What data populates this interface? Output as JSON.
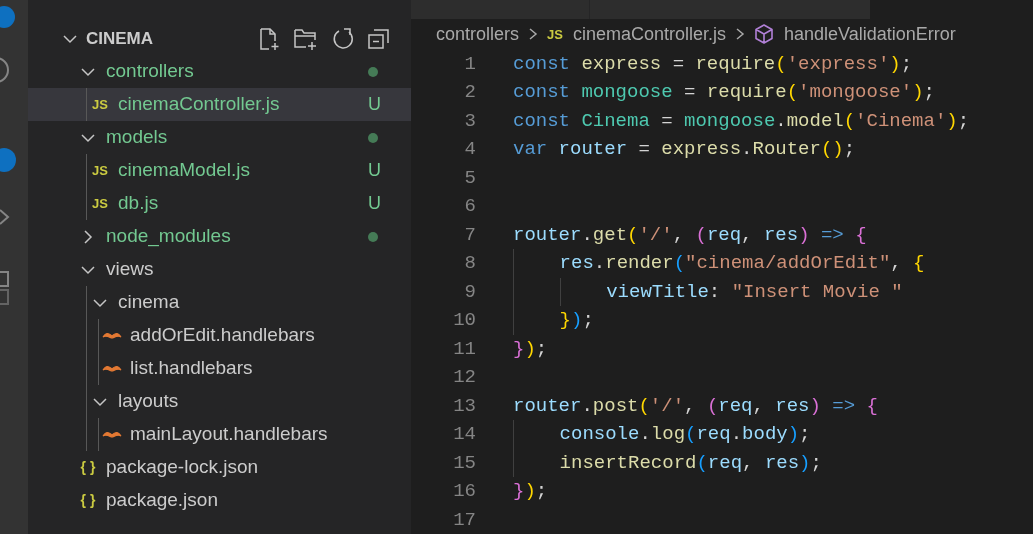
{
  "explorer": {
    "folder": "CINEMA",
    "expanded": true,
    "tree": [
      {
        "name": "controllers",
        "kind": "folder",
        "expanded": true,
        "untracked": true,
        "dot": true,
        "selected": false,
        "children": [
          {
            "name": "cinemaController.js",
            "kind": "js",
            "icon_text": "JS",
            "untracked": true,
            "status": "U",
            "selected": true
          }
        ]
      },
      {
        "name": "models",
        "kind": "folder",
        "expanded": true,
        "untracked": true,
        "dot": true,
        "selected": false,
        "children": [
          {
            "name": "cinemaModel.js",
            "kind": "js",
            "icon_text": "JS",
            "untracked": true,
            "status": "U",
            "selected": false
          },
          {
            "name": "db.js",
            "kind": "js",
            "icon_text": "JS",
            "untracked": true,
            "status": "U",
            "selected": false
          }
        ]
      },
      {
        "name": "node_modules",
        "kind": "folder",
        "expanded": false,
        "untracked": true,
        "dot": true,
        "selected": false
      },
      {
        "name": "views",
        "kind": "folder",
        "expanded": true,
        "untracked": false,
        "dot": false,
        "selected": false,
        "children": [
          {
            "name": "cinema",
            "kind": "folder",
            "expanded": true,
            "untracked": false,
            "dot": false,
            "selected": false,
            "children": [
              {
                "name": "addOrEdit.handlebars",
                "kind": "handlebars",
                "untracked": false,
                "selected": false
              },
              {
                "name": "list.handlebars",
                "kind": "handlebars",
                "untracked": false,
                "selected": false
              }
            ]
          },
          {
            "name": "layouts",
            "kind": "folder",
            "expanded": true,
            "untracked": false,
            "dot": false,
            "selected": false,
            "children": [
              {
                "name": "mainLayout.handlebars",
                "kind": "handlebars",
                "untracked": false,
                "selected": false
              }
            ]
          }
        ]
      },
      {
        "name": "package-lock.json",
        "kind": "json",
        "icon_text": "{ }",
        "untracked": false,
        "selected": false
      },
      {
        "name": "package.json",
        "kind": "json",
        "icon_text": "{ }",
        "untracked": false,
        "selected": false
      }
    ]
  },
  "breadcrumb": [
    {
      "kind": "folder",
      "label": "controllers"
    },
    {
      "kind": "js",
      "icon_text": "JS",
      "label": "cinemaController.js"
    },
    {
      "kind": "symbol",
      "label": "handleValidationError"
    }
  ],
  "code": [
    {
      "number": "1",
      "tokens": [
        {
          "text": "const",
          "kind": "kw"
        },
        {
          "text": " express",
          "kind": "fn"
        },
        {
          "text": " = ",
          "kind": "p"
        },
        {
          "text": "require",
          "kind": "fn"
        },
        {
          "text": "(",
          "kind": "b1"
        },
        {
          "text": "'express'",
          "kind": "str"
        },
        {
          "text": ")",
          "kind": "b1"
        },
        {
          "text": ";",
          "kind": "p"
        }
      ]
    },
    {
      "number": "2",
      "tokens": [
        {
          "text": "const",
          "kind": "kw"
        },
        {
          "text": " mongoose",
          "kind": "type"
        },
        {
          "text": " = ",
          "kind": "p"
        },
        {
          "text": "require",
          "kind": "fn"
        },
        {
          "text": "(",
          "kind": "b1"
        },
        {
          "text": "'mongoose'",
          "kind": "str"
        },
        {
          "text": ")",
          "kind": "b1"
        },
        {
          "text": ";",
          "kind": "p"
        }
      ]
    },
    {
      "number": "3",
      "tokens": [
        {
          "text": "const",
          "kind": "kw"
        },
        {
          "text": " Cinema",
          "kind": "type"
        },
        {
          "text": " = ",
          "kind": "p"
        },
        {
          "text": "mongoose",
          "kind": "type"
        },
        {
          "text": ".",
          "kind": "p"
        },
        {
          "text": "model",
          "kind": "fn"
        },
        {
          "text": "(",
          "kind": "b1"
        },
        {
          "text": "'Cinema'",
          "kind": "str"
        },
        {
          "text": ")",
          "kind": "b1"
        },
        {
          "text": ";",
          "kind": "p"
        }
      ]
    },
    {
      "number": "4",
      "tokens": [
        {
          "text": "var",
          "kind": "kw"
        },
        {
          "text": " router",
          "kind": "var"
        },
        {
          "text": " = ",
          "kind": "p"
        },
        {
          "text": "express",
          "kind": "fn"
        },
        {
          "text": ".",
          "kind": "p"
        },
        {
          "text": "Router",
          "kind": "fn"
        },
        {
          "text": "()",
          "kind": "b1"
        },
        {
          "text": ";",
          "kind": "p"
        }
      ]
    },
    {
      "number": "5"
    },
    {
      "number": "6"
    },
    {
      "number": "7",
      "tokens": [
        {
          "text": "router",
          "kind": "var"
        },
        {
          "text": ".",
          "kind": "p"
        },
        {
          "text": "get",
          "kind": "fn"
        },
        {
          "text": "(",
          "kind": "b1"
        },
        {
          "text": "'/'",
          "kind": "str"
        },
        {
          "text": ", ",
          "kind": "p"
        },
        {
          "text": "(",
          "kind": "b2"
        },
        {
          "text": "req",
          "kind": "var"
        },
        {
          "text": ", ",
          "kind": "p"
        },
        {
          "text": "res",
          "kind": "var"
        },
        {
          "text": ")",
          "kind": "b2"
        },
        {
          "text": " =>",
          "kind": "kw"
        },
        {
          "text": " {",
          "kind": "b2"
        }
      ]
    },
    {
      "number": "8",
      "tokens": [
        {
          "text": "    res",
          "kind": "var"
        },
        {
          "text": ".",
          "kind": "p"
        },
        {
          "text": "render",
          "kind": "fn"
        },
        {
          "text": "(",
          "kind": "b3"
        },
        {
          "text": "\"cinema/addOrEdit\"",
          "kind": "str"
        },
        {
          "text": ", ",
          "kind": "p"
        },
        {
          "text": "{",
          "kind": "b1"
        }
      ]
    },
    {
      "number": "9",
      "tokens": [
        {
          "text": "        viewTitle",
          "kind": "var"
        },
        {
          "text": ": ",
          "kind": "p"
        },
        {
          "text": "\"Insert Movie \"",
          "kind": "str"
        }
      ]
    },
    {
      "number": "10",
      "tokens": [
        {
          "text": "    }",
          "kind": "b1"
        },
        {
          "text": ")",
          "kind": "b3"
        },
        {
          "text": ";",
          "kind": "p"
        }
      ]
    },
    {
      "number": "11",
      "tokens": [
        {
          "text": "}",
          "kind": "b2"
        },
        {
          "text": ")",
          "kind": "b1"
        },
        {
          "text": ";",
          "kind": "p"
        }
      ]
    },
    {
      "number": "12"
    },
    {
      "number": "13",
      "tokens": [
        {
          "text": "router",
          "kind": "var"
        },
        {
          "text": ".",
          "kind": "p"
        },
        {
          "text": "post",
          "kind": "fn"
        },
        {
          "text": "(",
          "kind": "b1"
        },
        {
          "text": "'/'",
          "kind": "str"
        },
        {
          "text": ", ",
          "kind": "p"
        },
        {
          "text": "(",
          "kind": "b2"
        },
        {
          "text": "req",
          "kind": "var"
        },
        {
          "text": ", ",
          "kind": "p"
        },
        {
          "text": "res",
          "kind": "var"
        },
        {
          "text": ")",
          "kind": "b2"
        },
        {
          "text": " =>",
          "kind": "kw"
        },
        {
          "text": " {",
          "kind": "b2"
        }
      ]
    },
    {
      "number": "14",
      "tokens": [
        {
          "text": "    console",
          "kind": "var"
        },
        {
          "text": ".",
          "kind": "p"
        },
        {
          "text": "log",
          "kind": "fn"
        },
        {
          "text": "(",
          "kind": "b3"
        },
        {
          "text": "req",
          "kind": "var"
        },
        {
          "text": ".",
          "kind": "p"
        },
        {
          "text": "body",
          "kind": "var"
        },
        {
          "text": ")",
          "kind": "b3"
        },
        {
          "text": ";",
          "kind": "p"
        }
      ]
    },
    {
      "number": "15",
      "tokens": [
        {
          "text": "    insertRecord",
          "kind": "fn"
        },
        {
          "text": "(",
          "kind": "b3"
        },
        {
          "text": "req",
          "kind": "var"
        },
        {
          "text": ", ",
          "kind": "p"
        },
        {
          "text": "res",
          "kind": "var"
        },
        {
          "text": ")",
          "kind": "b3"
        },
        {
          "text": ";",
          "kind": "p"
        }
      ]
    },
    {
      "number": "16",
      "tokens": [
        {
          "text": "}",
          "kind": "b2"
        },
        {
          "text": ")",
          "kind": "b1"
        },
        {
          "text": ";",
          "kind": "p"
        }
      ]
    },
    {
      "number": "17"
    }
  ]
}
